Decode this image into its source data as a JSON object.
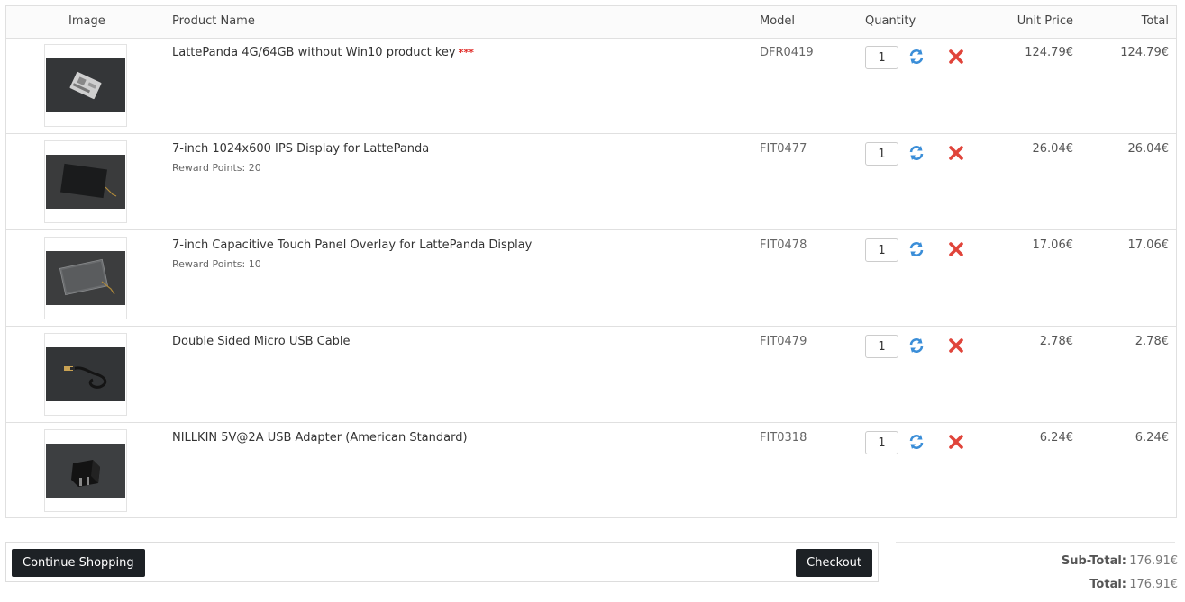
{
  "table": {
    "headers": {
      "image": "Image",
      "product_name": "Product Name",
      "model": "Model",
      "quantity": "Quantity",
      "unit_price": "Unit Price",
      "total": "Total"
    },
    "rows": [
      {
        "name": "LattePanda 4G/64GB without Win10 product key",
        "required_marker": "***",
        "reward": "",
        "model": "DFR0419",
        "qty": "1",
        "unit_price": "124.79€",
        "total": "124.79€"
      },
      {
        "name": "7-inch 1024x600 IPS Display for LattePanda",
        "required_marker": "",
        "reward": "Reward Points: 20",
        "model": "FIT0477",
        "qty": "1",
        "unit_price": "26.04€",
        "total": "26.04€"
      },
      {
        "name": "7-inch Capacitive Touch Panel Overlay for LattePanda Display",
        "required_marker": "",
        "reward": "Reward Points: 10",
        "model": "FIT0478",
        "qty": "1",
        "unit_price": "17.06€",
        "total": "17.06€"
      },
      {
        "name": "Double Sided Micro USB Cable",
        "required_marker": "",
        "reward": "",
        "model": "FIT0479",
        "qty": "1",
        "unit_price": "2.78€",
        "total": "2.78€"
      },
      {
        "name": "NILLKIN 5V@2A USB Adapter (American Standard)",
        "required_marker": "",
        "reward": "",
        "model": "FIT0318",
        "qty": "1",
        "unit_price": "6.24€",
        "total": "6.24€"
      }
    ]
  },
  "actions": {
    "continue_label": "Continue Shopping",
    "checkout_label": "Checkout"
  },
  "summary": {
    "subtotal_label": "Sub-Total:",
    "subtotal_value": "176.91€",
    "total_label": "Total:",
    "total_value": "176.91€"
  },
  "colors": {
    "button_bg": "#1d2125",
    "required_marker": "#e02b27",
    "refresh_icon": "#3b8ed8",
    "remove_icon": "#e0443a"
  },
  "icons": {
    "update": "refresh-icon",
    "remove": "remove-icon"
  }
}
